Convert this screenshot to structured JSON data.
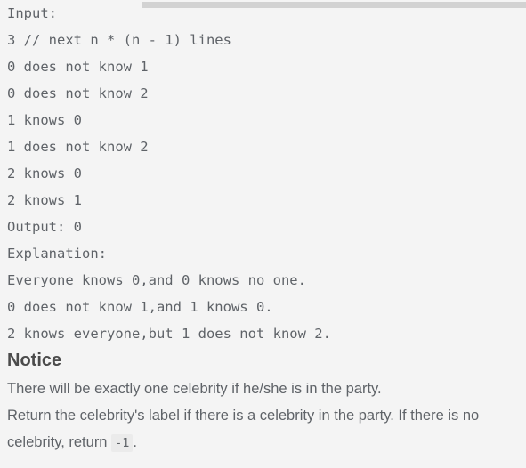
{
  "panel": {
    "background_color": "#f4f4f4",
    "text_color": "#5f6368",
    "heading_color": "#4b4b4b"
  },
  "scrollbar": {
    "name": "horizontal-scrollbar",
    "thumb_color": "#d2d2d2",
    "track_color": "#f4f4f4",
    "orientation": "horizontal"
  },
  "example": {
    "lines": [
      "Input:",
      "3 // next n * (n - 1) lines",
      "0 does not know 1",
      "0 does not know 2",
      "1 knows 0",
      "1 does not know 2",
      "2 knows 0",
      "2 knows 1",
      "Output: 0",
      "Explanation:",
      "Everyone knows 0,and 0 knows no one.",
      "0 does not know 1,and 1 knows 0.",
      "2 knows everyone,but 1 does not know 2."
    ]
  },
  "notice": {
    "heading": "Notice",
    "paragraph_1": "There will be exactly one celebrity if he/she is in the party.",
    "paragraph_2_before": "Return the celebrity's label if there is a celebrity in the party. If there is no celebrity, return",
    "paragraph_2_code": "-1",
    "paragraph_2_after": "."
  }
}
